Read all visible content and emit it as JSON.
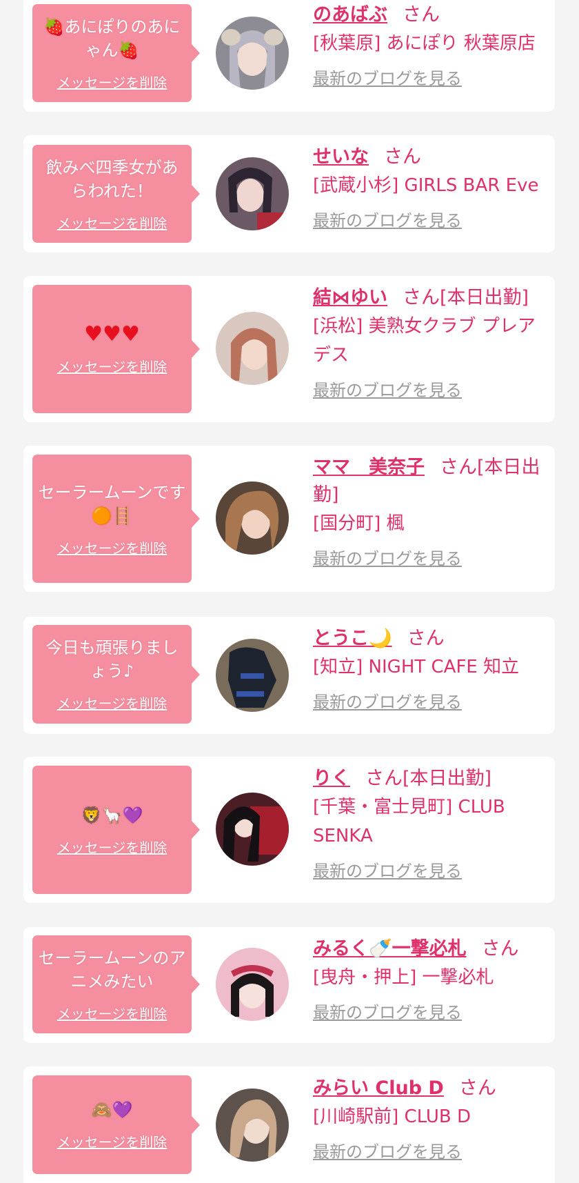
{
  "messages": [
    {
      "message": "🍓あにぽりのあにゃん🍓",
      "delete_label": "メッセージを削除",
      "name": "のあばぶ",
      "suffix": "さん",
      "shop": "[秋葉原] あにぽり 秋葉原店",
      "blog_label": "最新のブログを見る",
      "avatar_color": "#8d8c95"
    },
    {
      "message": "飲みべ四季女があらわれた！",
      "delete_label": "メッセージを削除",
      "name": "せいな",
      "suffix": "さん",
      "shop": "[武蔵小杉] GIRLS BAR Eve",
      "blog_label": "最新のブログを見る",
      "avatar_color": "#6b5a66"
    },
    {
      "message": "♥♥♥",
      "delete_label": "メッセージを削除",
      "name": "結⋈ゆい",
      "suffix": "さん[本日出勤]",
      "shop": "[浜松] 美熟女クラブ プレアデス",
      "blog_label": "最新のブログを見る",
      "avatar_color": "#c99a86"
    },
    {
      "message": "セーラームーンです🟠🪜",
      "delete_label": "メッセージを削除",
      "name": "ママ　美奈子",
      "suffix": "さん[本日出勤]",
      "shop": "[国分町] 楓",
      "blog_label": "最新のブログを見る",
      "avatar_color": "#8a6650"
    },
    {
      "message": "今日も頑張りましょう♪",
      "delete_label": "メッセージを削除",
      "name": "とうこ🌙",
      "suffix": "さん",
      "shop": "[知立] NIGHT CAFE 知立",
      "blog_label": "最新のブログを見る",
      "avatar_color": "#3d4250"
    },
    {
      "message": "🦁🦙💜",
      "delete_label": "メッセージを削除",
      "name": "りく",
      "suffix": "さん[本日出勤]",
      "shop": "[千葉・富士見町] CLUB SENKA",
      "blog_label": "最新のブログを見る",
      "avatar_color": "#5a2a30"
    },
    {
      "message": "セーラームーンのアニメみたい",
      "delete_label": "メッセージを削除",
      "name": "みるく🍼一撃必札",
      "suffix": "さん",
      "shop": "[曳舟・押上] 一撃必札",
      "blog_label": "最新のブログを見る",
      "avatar_color": "#e7a7b8"
    },
    {
      "message": "🙈💜",
      "delete_label": "メッセージを削除",
      "name": "みらい Club D",
      "suffix": "さん",
      "shop": "[川崎駅前] CLUB D",
      "blog_label": "最新のブログを見る",
      "avatar_color": "#7c6a5e"
    }
  ]
}
